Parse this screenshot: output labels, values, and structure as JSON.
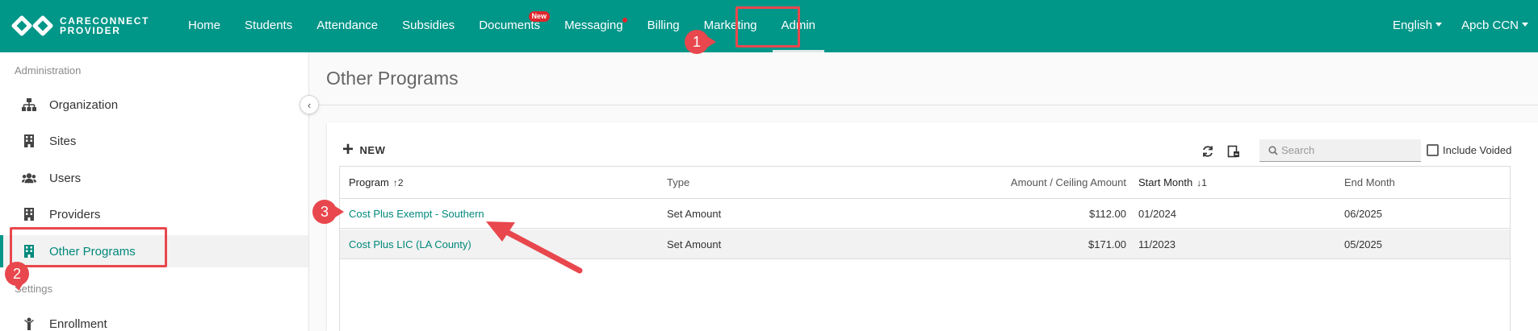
{
  "app": {
    "logo_line1": "CARECONNECT",
    "logo_line2": "PROVIDER",
    "brand_color": "#009688",
    "accent_color": "#00897b",
    "annotation_color": "#e8474d"
  },
  "nav": {
    "items": [
      {
        "label": "Home"
      },
      {
        "label": "Students"
      },
      {
        "label": "Attendance"
      },
      {
        "label": "Subsidies"
      },
      {
        "label": "Documents",
        "badge": "New"
      },
      {
        "label": "Messaging",
        "dot": true
      },
      {
        "label": "Billing"
      },
      {
        "label": "Marketing"
      },
      {
        "label": "Admin",
        "active": true
      }
    ],
    "language": "English",
    "account": "Apcb CCN"
  },
  "sidebar": {
    "administration_label": "Administration",
    "settings_label": "Settings",
    "items": [
      {
        "label": "Organization",
        "icon": "sitemap-icon"
      },
      {
        "label": "Sites",
        "icon": "building-icon"
      },
      {
        "label": "Users",
        "icon": "users-icon"
      },
      {
        "label": "Providers",
        "icon": "building-icon"
      },
      {
        "label": "Other Programs",
        "icon": "building-icon",
        "active": true
      },
      {
        "label": "Enrollment",
        "icon": "child-icon"
      }
    ],
    "collapse_icon": "‹"
  },
  "main": {
    "title": "Other Programs",
    "toolbar": {
      "new_label": "NEW",
      "search_placeholder": "Search",
      "include_voided_label": "Include Voided",
      "include_voided_checked": false
    },
    "table": {
      "columns": {
        "program": "Program",
        "program_sort": "↑2",
        "type": "Type",
        "amount": "Amount / Ceiling Amount",
        "start_month": "Start Month",
        "start_sort": "↓1",
        "end_month": "End Month"
      },
      "rows": [
        {
          "program": "Cost Plus Exempt - Southern",
          "type": "Set Amount",
          "amount": "$112.00",
          "start_month": "01/2024",
          "end_month": "06/2025"
        },
        {
          "program": "Cost Plus LIC (LA County)",
          "type": "Set Amount",
          "amount": "$171.00",
          "start_month": "11/2023",
          "end_month": "05/2025"
        }
      ]
    }
  },
  "annotations": {
    "step1": "1",
    "step2": "2",
    "step3": "3"
  }
}
